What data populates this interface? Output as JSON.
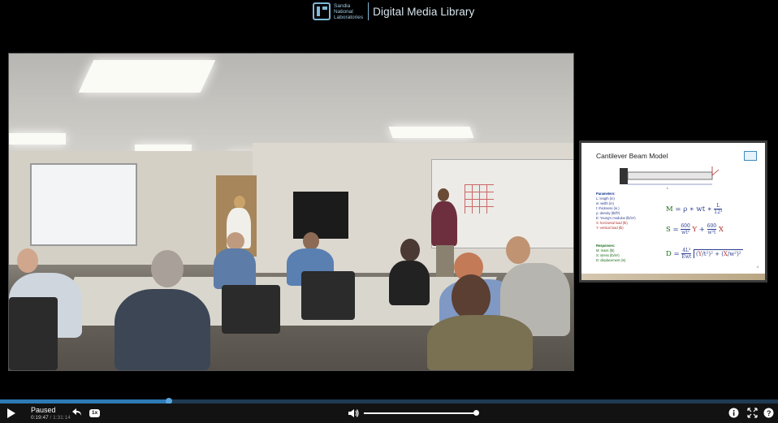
{
  "header": {
    "logo_lines": [
      "Sandia",
      "National",
      "Laboratories"
    ],
    "site_title": "Digital Media Library"
  },
  "slide": {
    "title": "Cantilever Beam Model",
    "beam_label": "L",
    "parameters_header": "Parameters:",
    "parameters": [
      {
        "text": "L: length (in)",
        "color": "blue"
      },
      {
        "text": "w: width (in)",
        "color": "blue"
      },
      {
        "text": "t: thickness (in.)",
        "color": "blue"
      },
      {
        "text": "ρ: density (lb/ft³)",
        "color": "blue"
      },
      {
        "text": "E: Young's modulus (lb/in²)",
        "color": "blue"
      },
      {
        "text": "X: horizontal load (lb)",
        "color": "red"
      },
      {
        "text": "Y: vertical load (lb)",
        "color": "red"
      }
    ],
    "responses_header": "Responses:",
    "responses": [
      "M: mass (lb)",
      "S: stress (lb/in²)",
      "D: displacement (in)"
    ],
    "slide_number": "4"
  },
  "player": {
    "status": "Paused",
    "current_time": "0:19:47",
    "time_separator": "/",
    "duration": "1:31:14",
    "speed": "1x",
    "progress_fraction": 0.217,
    "volume_fraction": 1.0,
    "icons": [
      "play-icon",
      "rewind-icon",
      "volume-icon",
      "info-icon",
      "fullscreen-icon",
      "help-icon"
    ]
  },
  "colors": {
    "accent": "#2e7ab5",
    "header_text": "#d8e6ee",
    "logo": "#7fb8d8"
  }
}
